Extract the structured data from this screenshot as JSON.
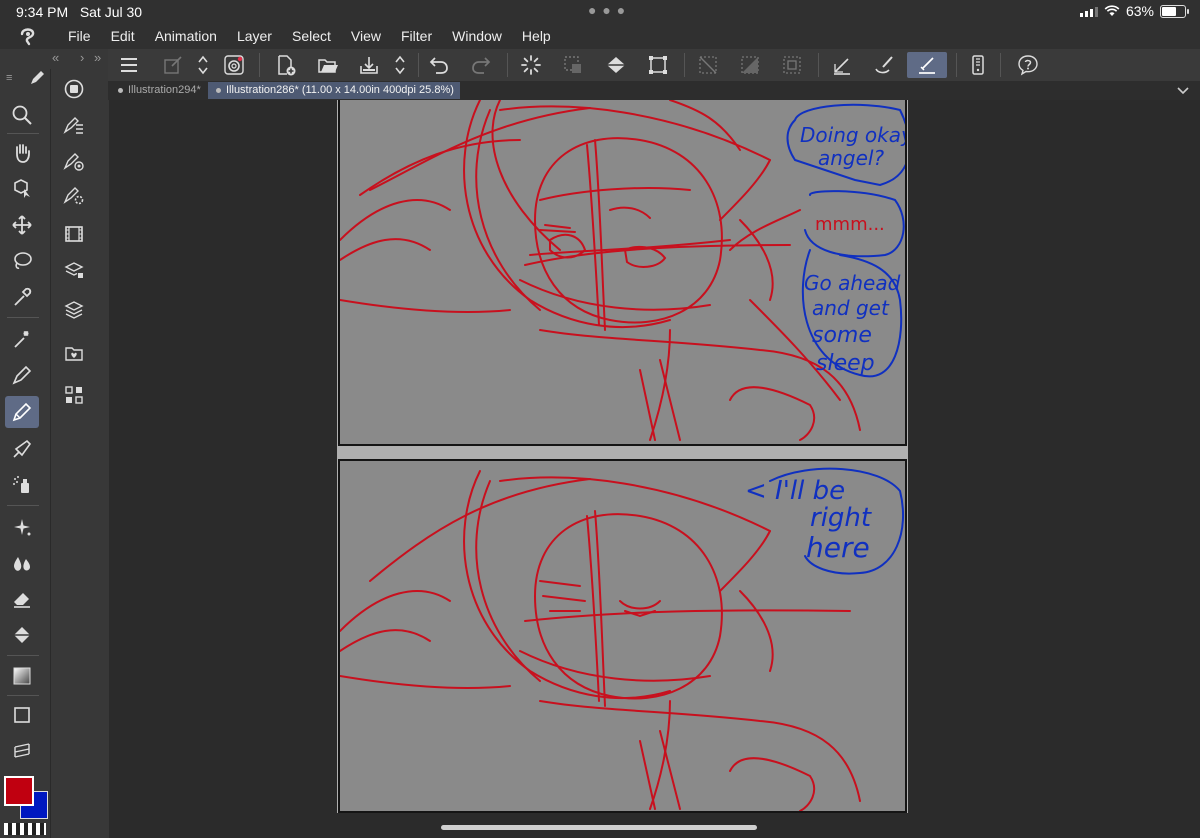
{
  "status": {
    "time": "9:34 PM",
    "date": "Sat Jul 30",
    "battery": "63%",
    "battery_level": 0.63
  },
  "menu": [
    "File",
    "Edit",
    "Animation",
    "Layer",
    "Select",
    "View",
    "Filter",
    "Window",
    "Help"
  ],
  "tabs": [
    {
      "label": "Illustration294*",
      "active": false
    },
    {
      "label": "Illustration286* (11.00 x 14.00in 400dpi 25.8%)",
      "active": true
    }
  ],
  "colors": {
    "main": "#c00010",
    "sub": "#0018c0",
    "accent": "#5f6b86"
  },
  "tools": [
    "magnifier-icon",
    "hand-icon",
    "object-icon",
    "move-icon",
    "lasso-icon",
    "eyedropper-icon",
    "magic-wand-icon",
    "pen-icon",
    "pencil-icon",
    "brush-icon",
    "airbrush-icon",
    "decoration-icon",
    "blend-icon",
    "eraser-icon",
    "fill-icon",
    "gradient-icon",
    "figure-icon",
    "frame-icon"
  ],
  "subtools": [
    "navigator-icon",
    "sub-tool-icon",
    "tool-property-icon",
    "brush-size-icon",
    "timeline-icon",
    "layer-property-icon",
    "layer-icon",
    "material-icon",
    "quick-access-icon"
  ],
  "dialogue": {
    "panel1_bubble1": [
      "Doing okay",
      "angel?"
    ],
    "panel1_bubble2": "mmm...",
    "panel1_bubble3": [
      "Go ahead",
      "and get",
      "some",
      "sleep"
    ],
    "panel2_bubble1": [
      "< I'll be",
      "right",
      "here"
    ]
  }
}
